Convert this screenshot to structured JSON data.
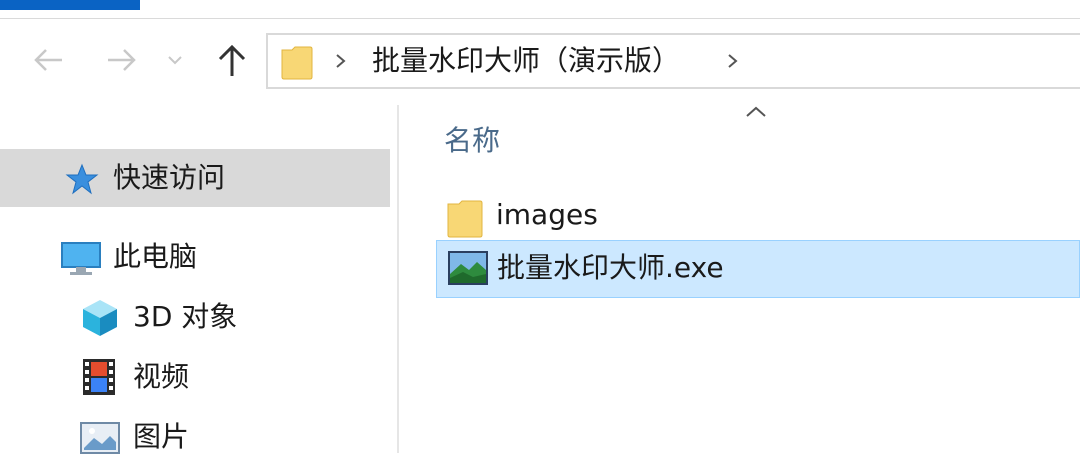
{
  "address_bar": {
    "path_segment": "批量水印大师（演示版）"
  },
  "sidebar": {
    "items": [
      {
        "label": "快速访问",
        "icon": "star-pin-icon"
      },
      {
        "label": "此电脑",
        "icon": "computer-icon"
      },
      {
        "label": "3D 对象",
        "icon": "3d-object-icon"
      },
      {
        "label": "视频",
        "icon": "video-icon"
      },
      {
        "label": "图片",
        "icon": "pictures-icon"
      }
    ]
  },
  "file_list": {
    "column_header": "名称",
    "items": [
      {
        "name": "images",
        "icon": "folder-icon",
        "selected": false
      },
      {
        "name": "批量水印大师.exe",
        "icon": "application-icon",
        "selected": true
      }
    ]
  },
  "colors": {
    "accent": "#0a63c4",
    "selection_bg": "#cce8ff",
    "selection_border": "#99d1ff",
    "sidebar_selected_bg": "#d9d9d9",
    "folder_yellow": "#f8d775"
  }
}
